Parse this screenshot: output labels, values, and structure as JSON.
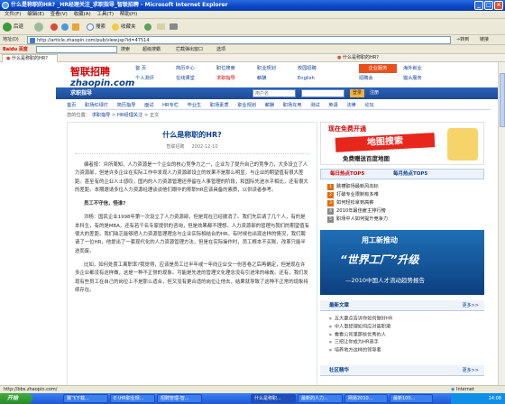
{
  "window": {
    "title": "什么是称职的HR? _HR经理关注_求职指导_智联招聘 - Microsoft Internet Explorer"
  },
  "menu": [
    "文件(F)",
    "编辑(E)",
    "查看(V)",
    "收藏(A)",
    "工具(T)",
    "帮助(H)"
  ],
  "toolbar": {
    "back": "后退",
    "search": "搜索",
    "favorites": "收藏夹"
  },
  "address": {
    "label": "地址(D)",
    "url": "http://article.zhaopin.com/pub/view.jsp?id=47514",
    "go": "转到",
    "links": "链接"
  },
  "linksbar": {
    "logo": "Baidu 百度",
    "search_btn": "搜索",
    "items": [
      "超级搜霸",
      "拦截弹出窗口",
      "选项"
    ]
  },
  "tabs": [
    "什么是称职的HR?",
    "什么是称职的HR?"
  ],
  "site": {
    "logo_cn": "智联招聘",
    "logo_en": "zhaopin.com",
    "nav_row1": [
      "首 页",
      "简历中心",
      "职位搜索",
      "职业规划",
      "校园招聘",
      "企业服务",
      "海外就业"
    ],
    "nav_row2": [
      "个人测评",
      "在线课堂",
      "求职指导",
      "薪酬",
      "招聘会",
      "English",
      "猎头服务"
    ],
    "header_right_btn": "企业服务",
    "section_title": "求职指导",
    "search_placeholder": "用户名",
    "login_btn": "登录",
    "register": "注册",
    "subnav": [
      "首页",
      "职场红绿灯",
      "简历指导",
      "面试",
      "HR专栏",
      "毕业生",
      "职场素质",
      "职业规划",
      "薪酬",
      "职场充电",
      "测试",
      "英语",
      "法律",
      "论坛"
    ],
    "breadcrumb": [
      "您的位置：",
      "求职指导",
      "HR经理关注",
      "正文"
    ]
  },
  "article": {
    "title": "什么是称职的HR?",
    "author": "智联招聘",
    "date": "2002-12-10",
    "paragraphs": [
      "编者按：众所周知，人力资源是一个企业的核心竞争力之一，企业为了提升自己的竞争力，大多设立了人力资源部，但是许多企业在实际工作中发现人力资源部设立的效果不是那么明显，与企业的期望值有很大差距。甚至有的企业人士感叹，国内的人力资源管理还停留在人事管理的阶段，和国际先进水平相比，还有很大的差距。本期邀请多位人力资源经理谈谈他们眼中的称职HR应该具备的素质，以供读者参考。",
      "员工不守信，怪谁?",
      "洪杨：国民企业1998年第一次设立了人力资源部，但是现在已经撤消了。我们先后请了几个人，有的是本科生，有的是MBA，还有若干名专家提供的咨询，但是效果都不理想。人力资源部的管理与我们的期望值有很大的差距。我们缺乏能够把人力资源管理理念与企业实际相结合的HR。有时候也出现这样的情况，我们聘请了一位HR，他提出了一套现代化的人力资源管理方法，但是在实际操作时，员工根本不买账，改革只能半途而废。",
      "比如，如何处置工离职率?我觉得，应该是员工过半年或一年向企业交一份答卷之后再确定，但是现在许多企业都没有这样做，这是一种不正常的现象。可能是先进的管理文化理念没有引进来的缘故。还有，我们发现有些员工在自己的岗位上不是那么适合，但又没有更合适的岗位让他去，结果就导致了这种不正常的现象持续存在。"
    ]
  },
  "sidebar": {
    "ad1_title": "现在免费开通",
    "ad1_text": "地图搜索",
    "ad1_sub": "免费赠送百度地图",
    "tabs": [
      "每日热点TOP5",
      "每月热点TOP5"
    ],
    "hot_list": [
      "跳槽职场最新风向标",
      "打破专业限制有多难",
      "如何轻松拿到高薪",
      "2010年最佳雇主排行榜",
      "职场中人如何提升竞争力"
    ],
    "ad2_title": "用工新推动",
    "ad2_big": "“世界工厂”升级",
    "ad2_sub": "—2010中国人才流动趋势报告",
    "latest_title": "最新文章",
    "more": "更多>>",
    "latest_list": [
      "五大要点告诉你如何做好HR",
      "中人事经理如何应对离职潮",
      "看看公司里那些优秀的人",
      "三招让你成为HR高手",
      "培养地方这样的领导者"
    ],
    "community_title": "社区精华"
  },
  "status": {
    "text": "http://bbs.zhaopin.com/",
    "zone": "Internet"
  },
  "taskbar": {
    "start": "开始",
    "tasks": [
      "翼飞下载...",
      "E:\\HR职业规...",
      "招聘管理-智...",
      "什么是称职...",
      "最新的人力...",
      "网易2010...",
      "最新100..."
    ],
    "time": "14:08"
  }
}
